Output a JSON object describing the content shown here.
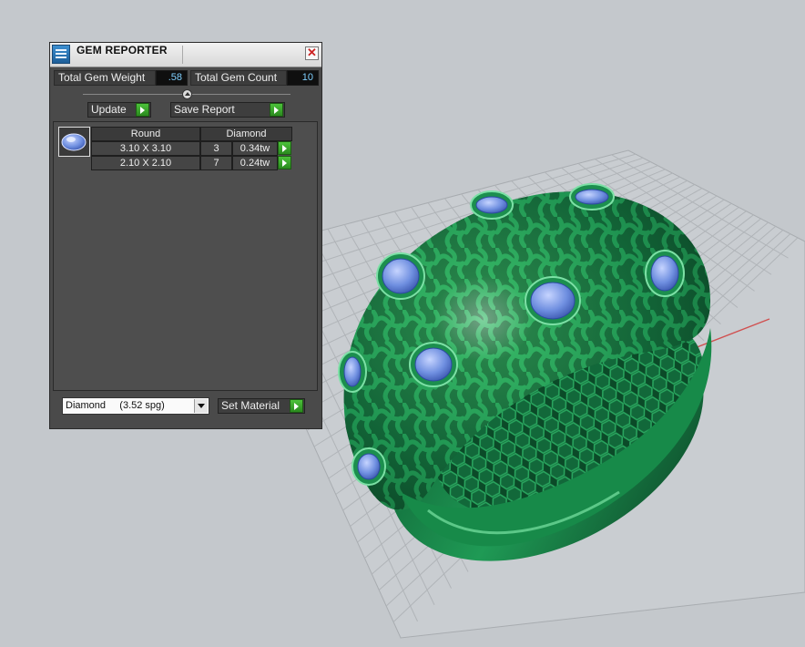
{
  "panel": {
    "title": "GEM REPORTER",
    "close_glyph": "✕",
    "total_weight_label": "Total Gem Weight",
    "total_weight_value": ".58",
    "total_count_label": "Total Gem Count",
    "total_count_value": "10",
    "update_label": "Update",
    "save_report_label": "Save Report",
    "table": {
      "headers": [
        "Round",
        "Diamond"
      ],
      "rows": [
        {
          "size": "3.10 X 3.10",
          "count": "3",
          "weight": "0.34tw"
        },
        {
          "size": "2.10 X 2.10",
          "count": "7",
          "weight": "0.24tw"
        }
      ]
    },
    "material_select": "Diamond     (3.52 spg)",
    "set_material_label": "Set Material"
  },
  "icons": [
    "app-logo-icon",
    "close-icon",
    "slider-knob-icon",
    "gem-thumbnail-icon",
    "play-arrow-icon",
    "dropdown-arrow-icon"
  ],
  "colors": {
    "ring": "#1f8a4c",
    "gems": "#6f8fe0",
    "panel_bg": "#4a4a4a",
    "value_text": "#7fd0ff",
    "accent_button": "#3aa52a"
  }
}
